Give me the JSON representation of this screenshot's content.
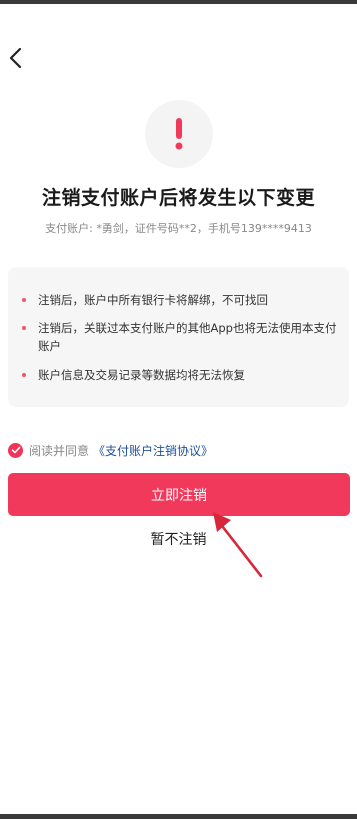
{
  "header": {
    "back_icon": "chevron-left-icon"
  },
  "alert": {
    "icon": "exclamation-icon",
    "color": "#f13a5b"
  },
  "title": "注销支付账户后将发生以下变更",
  "account_info": "支付账户: *勇剑，证件号码**2，手机号139****9413",
  "notices": [
    "注销后，账户中所有银行卡将解绑，不可找回",
    "注销后，关联过本支付账户的其他App也将无法使用本支付账户",
    "账户信息及交易记录等数据均将无法恢复"
  ],
  "agreement": {
    "checked": true,
    "label": "阅读并同意",
    "link": "《支付账户注销协议》"
  },
  "buttons": {
    "confirm": "立即注销",
    "cancel": "暂不注销"
  },
  "colors": {
    "accent": "#f13a5b",
    "link": "#1e4f9e",
    "annotation": "#d6283a"
  }
}
